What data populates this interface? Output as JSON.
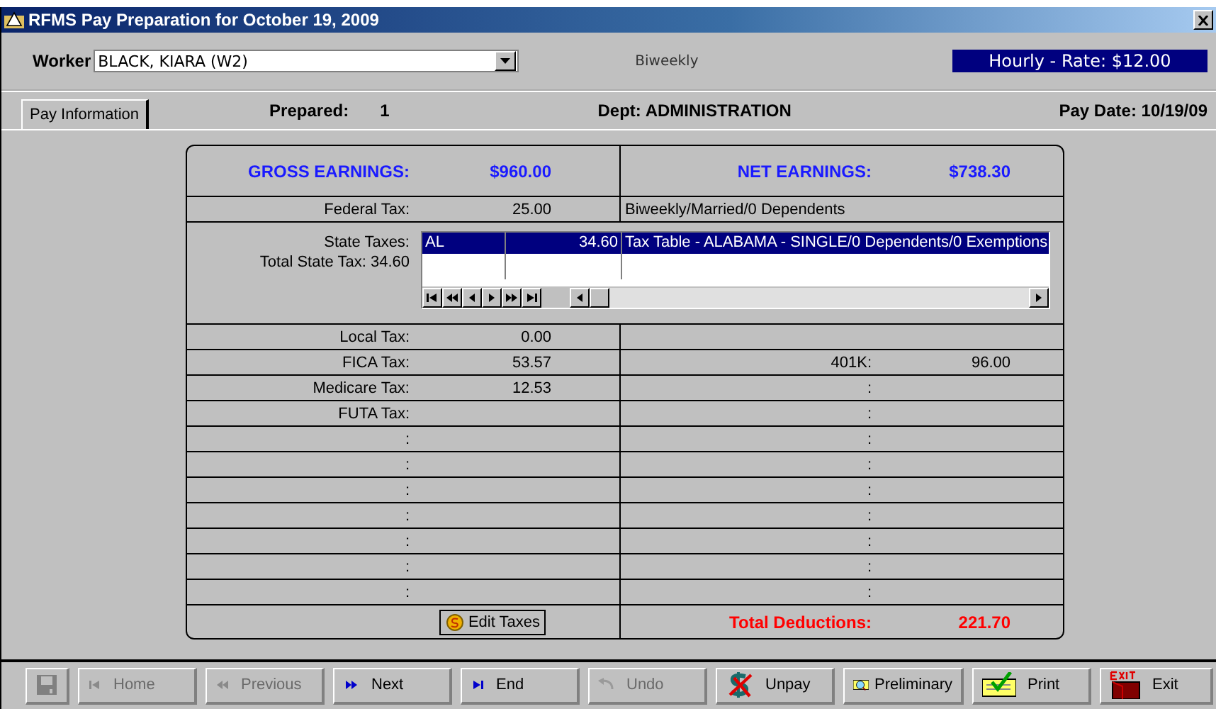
{
  "window": {
    "title": "RFMS Pay Preparation for October 19, 2009"
  },
  "worker": {
    "label": "Worker",
    "value": "BLACK, KIARA (W2)"
  },
  "pay_frequency": "Biweekly",
  "rate_badge": "Hourly - Rate: $12.00",
  "tabs": [
    {
      "label": "Pay Information",
      "selected": true
    }
  ],
  "info": {
    "prepared_label": "Prepared:",
    "prepared_value": "1",
    "dept": "Dept: ADMINISTRATION",
    "pay_date": "Pay Date: 10/19/09"
  },
  "earnings": {
    "gross_label": "GROSS EARNINGS:",
    "gross_value": "$960.00",
    "net_label": "NET EARNINGS:",
    "net_value": "$738.30"
  },
  "federal": {
    "label": "Federal Tax:",
    "value": "25.00",
    "detail": "Biweekly/Married/0 Dependents"
  },
  "state": {
    "label": "State Taxes:",
    "total": "Total State Tax: 34.60",
    "rows": [
      {
        "code": "AL",
        "amount": "34.60",
        "description": "Tax Table - ALABAMA - SINGLE/0 Dependents/0 Exemptions",
        "selected": true
      }
    ]
  },
  "left_rows": [
    {
      "label": "Local Tax:",
      "value": "0.00"
    },
    {
      "label": "FICA Tax:",
      "value": "53.57"
    },
    {
      "label": "Medicare Tax:",
      "value": "12.53"
    },
    {
      "label": "FUTA Tax:"
    },
    {
      "label": ":"
    },
    {
      "label": ":"
    },
    {
      "label": ":"
    },
    {
      "label": ":"
    },
    {
      "label": ":"
    },
    {
      "label": ":"
    },
    {
      "label": ":"
    }
  ],
  "right_rows": [
    {},
    {
      "label": "401K:",
      "value": "96.00"
    },
    {
      "label": ":"
    },
    {
      "label": ":"
    },
    {
      "label": ":"
    },
    {
      "label": ":"
    },
    {
      "label": ":"
    },
    {
      "label": ":"
    },
    {
      "label": ":"
    },
    {
      "label": ":"
    },
    {
      "label": ":"
    }
  ],
  "edit_taxes_button": "Edit Taxes",
  "total_deductions": {
    "label": "Total Deductions:",
    "value": "221.70"
  },
  "toolbar": [
    {
      "kind": "save",
      "disabled": true
    },
    {
      "kind": "home",
      "label": "Home",
      "disabled": true
    },
    {
      "kind": "previous",
      "label": "Previous",
      "disabled": true
    },
    {
      "kind": "next",
      "label": "Next",
      "disabled": false
    },
    {
      "kind": "end",
      "label": "End",
      "disabled": false
    },
    {
      "kind": "undo",
      "label": "Undo",
      "disabled": true
    },
    {
      "kind": "unpay",
      "label": "Unpay",
      "disabled": false
    },
    {
      "kind": "preliminary",
      "label": "Preliminary",
      "disabled": false
    },
    {
      "kind": "print",
      "label": "Print",
      "disabled": false
    },
    {
      "kind": "exit",
      "label": "Exit",
      "disabled": false
    }
  ]
}
